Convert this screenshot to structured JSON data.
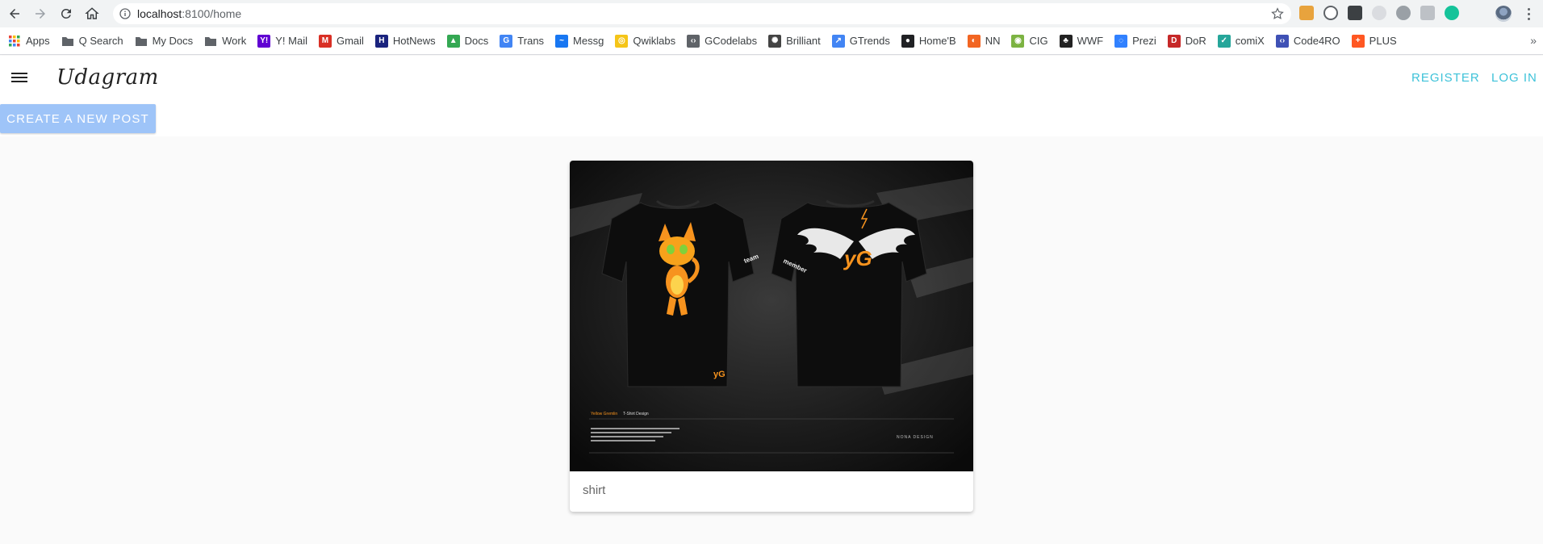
{
  "browser": {
    "url_host": "localhost",
    "url_path": ":8100/home",
    "bookmarks": [
      {
        "label": "Apps",
        "icon": "apps-grid-icon",
        "color": "#e8453c"
      },
      {
        "label": "Q Search",
        "icon": "folder-icon",
        "color": "#5f6368"
      },
      {
        "label": "My Docs",
        "icon": "folder-icon",
        "color": "#5f6368"
      },
      {
        "label": "Work",
        "icon": "folder-icon",
        "color": "#5f6368"
      },
      {
        "label": "Y! Mail",
        "icon": "yahoo-icon",
        "color": "#6001d2"
      },
      {
        "label": "Gmail",
        "icon": "gmail-icon",
        "color": "#d93025"
      },
      {
        "label": "HotNews",
        "icon": "hotnews-icon",
        "color": "#1a237e"
      },
      {
        "label": "Docs",
        "icon": "drive-icon",
        "color": "#34a853"
      },
      {
        "label": "Trans",
        "icon": "translate-icon",
        "color": "#4285f4"
      },
      {
        "label": "Messg",
        "icon": "messenger-icon",
        "color": "#1877f2"
      },
      {
        "label": "Qwiklabs",
        "icon": "qwiklabs-icon",
        "color": "#f5c518"
      },
      {
        "label": "GCodelabs",
        "icon": "code-icon",
        "color": "#5f6368"
      },
      {
        "label": "Brilliant",
        "icon": "brilliant-icon",
        "color": "#444444"
      },
      {
        "label": "GTrends",
        "icon": "trends-icon",
        "color": "#4285f4"
      },
      {
        "label": "Home'B",
        "icon": "globe-icon",
        "color": "#202124"
      },
      {
        "label": "NN",
        "icon": "nn-icon",
        "color": "#f26522"
      },
      {
        "label": "CIG",
        "icon": "cig-icon",
        "color": "#7cb342"
      },
      {
        "label": "WWF",
        "icon": "panda-icon",
        "color": "#222222"
      },
      {
        "label": "Prezi",
        "icon": "prezi-icon",
        "color": "#3181ff"
      },
      {
        "label": "DoR",
        "icon": "dor-icon",
        "color": "#c62828"
      },
      {
        "label": "comiX",
        "icon": "comix-icon",
        "color": "#26a69a"
      },
      {
        "label": "Code4RO",
        "icon": "brackets-icon",
        "color": "#3f51b5"
      },
      {
        "label": "PLUS",
        "icon": "plus-icon",
        "color": "#ff5722"
      }
    ],
    "more_label": "»"
  },
  "app": {
    "brand": "Udagram",
    "nav": {
      "register": "REGISTER",
      "login": "LOG IN"
    },
    "create_button": "CREATE A NEW POST",
    "accent_color": "#3dc2d9",
    "button_color": "#9ec4f8"
  },
  "feed": {
    "posts": [
      {
        "caption": "shirt",
        "image_text": {
          "left_badge": "team",
          "right_badge": "member",
          "logo": "yG",
          "footer_title_a": "Yellow Gremlin",
          "footer_title_b": "T-Shirt Design",
          "footer_brand": "NONA DESIGN"
        }
      }
    ]
  }
}
